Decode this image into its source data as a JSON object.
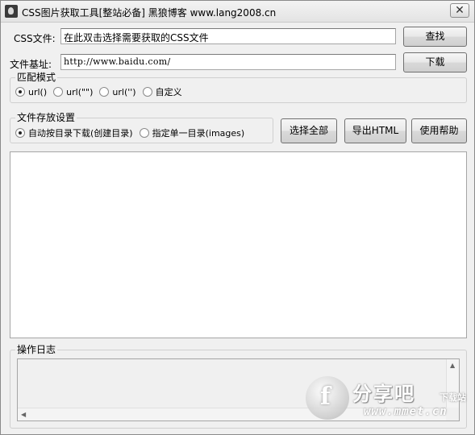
{
  "window": {
    "title": "CSS图片获取工具[整站必备] 黑狼博客 www.lang2008.cn",
    "close_glyph": "✕"
  },
  "css_file": {
    "label": "CSS文件:",
    "value": "在此双击选择需要获取的CSS文件",
    "button": "查找"
  },
  "base_url": {
    "label": "文件基址:",
    "value": "http://www.baidu.com/",
    "button": "下载"
  },
  "match_mode": {
    "title": "匹配模式",
    "options": [
      {
        "label": "url()",
        "selected": true
      },
      {
        "label": "url(\"\")",
        "selected": false
      },
      {
        "label": "url('')",
        "selected": false
      },
      {
        "label": "自定义",
        "selected": false
      }
    ]
  },
  "storage": {
    "title": "文件存放设置",
    "options": [
      {
        "label": "自动按目录下载(创建目录)",
        "selected": true
      },
      {
        "label": "指定单一目录(images)",
        "selected": false
      }
    ]
  },
  "actions": {
    "select_all": "选择全部",
    "export_html": "导出HTML",
    "help": "使用帮助"
  },
  "log": {
    "title": "操作日志"
  },
  "watermark": {
    "brand": "分享吧",
    "sub": "下载站",
    "url": "www.mmet.cn"
  }
}
